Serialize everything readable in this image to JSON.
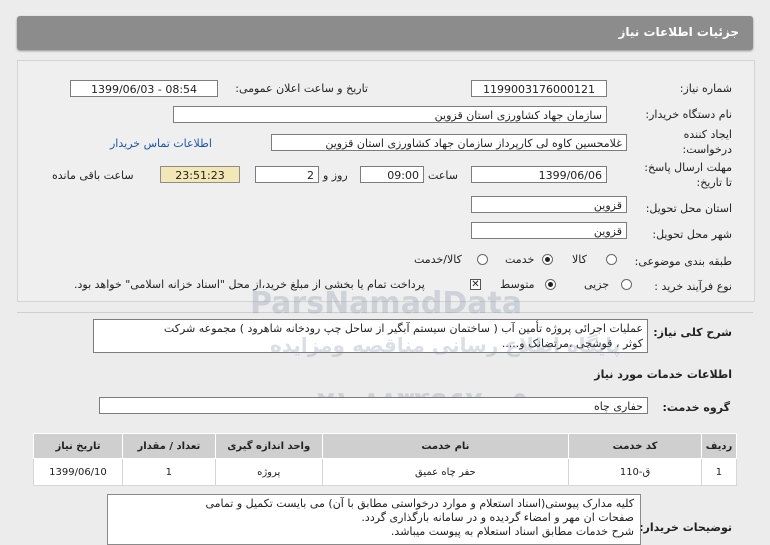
{
  "header": {
    "title": "جزئیات اطلاعات نیاز"
  },
  "fields": {
    "need_number_label": "شماره نیاز:",
    "need_number": "1199003176000121",
    "announce_label": "تاریخ و ساعت اعلان عمومی:",
    "announce_value": "1399/06/03 - 08:54",
    "buyer_label": "نام دستگاه خریدار:",
    "buyer_value": "سازمان جهاد کشاورزی استان قزوین",
    "creator_label_1": "ایجاد کننده",
    "creator_label_2": "درخواست:",
    "creator_value": "غلامحسین کاوه لی کارپرداز سازمان جهاد کشاورزی استان قزوین",
    "contact_link": "اطلاعات تماس خریدار",
    "deadline_label_1": "مهلت ارسال پاسخ:",
    "deadline_label_2": "تا تاریخ:",
    "deadline_date": "1399/06/06",
    "time_label": "ساعت",
    "deadline_time": "09:00",
    "day_label": "روز و",
    "days_value": "2",
    "remaining_time": "23:51:23",
    "remaining_label": "ساعت باقی مانده",
    "province_label": "استان محل تحویل:",
    "province_value": "قزوین",
    "city_label": "شهر محل تحویل:",
    "city_value": "قزوین",
    "category_label": "طبقه بندی موضوعی:",
    "category_options": [
      "کالا",
      "خدمت",
      "کالا/خدمت"
    ],
    "category_selected": "خدمت",
    "process_label": "نوع فرآیند خرید :",
    "process_options": [
      "جزیی",
      "متوسط"
    ],
    "process_selected": "متوسط",
    "payment_note": "پرداخت تمام یا بخشی از مبلغ خرید،از محل \"اسناد خزانه اسلامی\" خواهد بود."
  },
  "summary": {
    "label": "شرح کلی نیاز:",
    "line1": "عملیات اجرائی پروژه تأمین آب ( ساختمان سیستم آبگیر از ساحل چپ رودخانه شاهرود ) مجموعه شرکت",
    "line2": "کوثر ، قوشچی ،مرتضانک و....."
  },
  "services": {
    "section_title": "اطلاعات خدمات مورد نیاز",
    "group_label": "گروه خدمت:",
    "group_value": "حفاری چاه",
    "columns": [
      "ردیف",
      "کد خدمت",
      "نام خدمت",
      "واحد اندازه گیری",
      "تعداد / مقدار",
      "تاریخ نیاز"
    ],
    "rows": [
      {
        "row": "1",
        "code": "ق-110",
        "name": "حفر چاه عمیق",
        "unit": "پروژه",
        "qty": "1",
        "date": "1399/06/10"
      }
    ]
  },
  "buyer_notes": {
    "label": "توضیحات خریدار:",
    "line1": "کلیه مدارک پیوستی(اسناد استعلام و موارد درخواستی مطابق با آن) می بایست تکمیل و تمامی",
    "line2": "صفحات ان مهر و امضاء گردیده و در سامانه بارگذاری گردد.",
    "line3": "شرح خدمات مطابق اسناد استعلام به پیوست میباشد."
  },
  "watermark": {
    "line1": "ParsNamadData",
    "line2": "پایگاه اطلاع رسانی مناقصه ومزایده",
    "line3": "۰۲۱-۸۸۳۴۹۶۷۰-۵"
  }
}
